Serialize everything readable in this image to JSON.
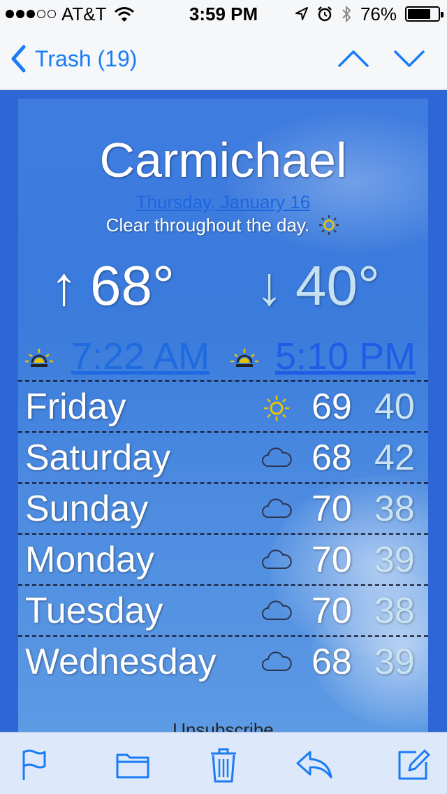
{
  "status_bar": {
    "carrier": "AT&T",
    "time": "3:59 PM",
    "battery_percent": "76%",
    "battery_level": 0.76,
    "signal_bars_filled": 3,
    "signal_bars_total": 5
  },
  "nav": {
    "back_label": "Trash (19)",
    "accent_color": "#1a7cf5"
  },
  "weather": {
    "city": "Carmichael",
    "date": "Thursday, January 16",
    "summary": "Clear throughout the day.",
    "high_arrow": "↑",
    "low_arrow": "↓",
    "high": "68°",
    "low": "40°",
    "sunrise": "7:22 AM",
    "sunset": "5:10 PM",
    "forecast": [
      {
        "day": "Friday",
        "icon": "sun-icon",
        "high": "69",
        "low": "40"
      },
      {
        "day": "Saturday",
        "icon": "cloud-icon",
        "high": "68",
        "low": "42"
      },
      {
        "day": "Sunday",
        "icon": "cloud-icon",
        "high": "70",
        "low": "38"
      },
      {
        "day": "Monday",
        "icon": "cloud-icon",
        "high": "70",
        "low": "39"
      },
      {
        "day": "Tuesday",
        "icon": "cloud-icon",
        "high": "70",
        "low": "38"
      },
      {
        "day": "Wednesday",
        "icon": "cloud-icon",
        "high": "68",
        "low": "39"
      }
    ],
    "unsubscribe": "Unsubscribe"
  },
  "toolbar": {
    "icons": [
      "flag-icon",
      "folder-icon",
      "trash-icon",
      "reply-icon",
      "compose-icon"
    ]
  }
}
